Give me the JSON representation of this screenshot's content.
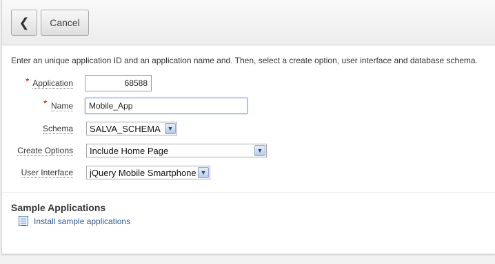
{
  "toolbar": {
    "back_glyph": "❮",
    "cancel_label": "Cancel"
  },
  "intro_text": "Enter an unique application ID and an application name and. Then, select a create option, user interface and database schema.",
  "form": {
    "application": {
      "label": "Application",
      "value": "68588",
      "required": true
    },
    "name": {
      "label": "Name",
      "value": "Mobile_App",
      "required": true
    },
    "schema": {
      "label": "Schema",
      "value": "SALVA_SCHEMA"
    },
    "create_options": {
      "label": "Create Options",
      "value": "Include Home Page"
    },
    "user_interface": {
      "label": "User Interface",
      "value": "jQuery Mobile Smartphone"
    }
  },
  "required_marker": "*",
  "sample_section": {
    "title": "Sample Applications",
    "link_label": "Install sample applications"
  },
  "colors": {
    "required": "#cc0000",
    "link": "#2e5a95",
    "focus_border": "#7a9ccf"
  }
}
